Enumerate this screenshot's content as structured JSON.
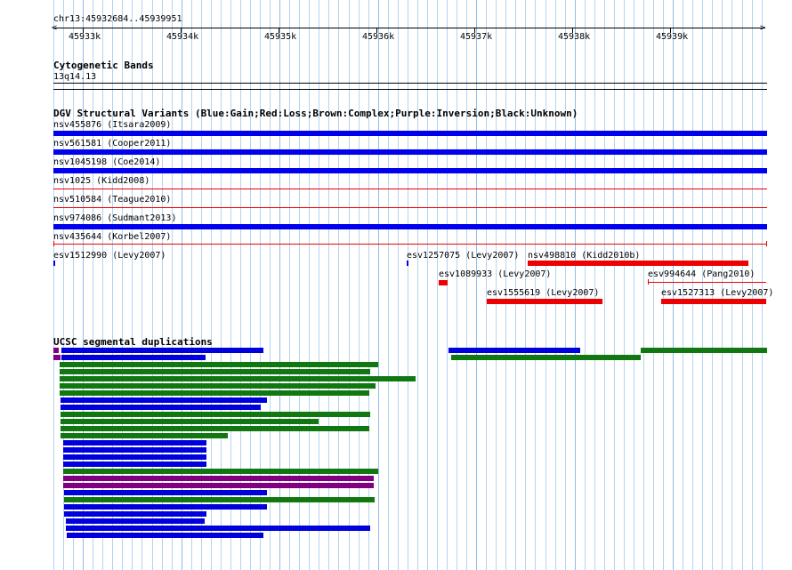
{
  "ruler": {
    "location": "chr13:45932684..45939951",
    "ticks": [
      "45933k",
      "45934k",
      "45935k",
      "45936k",
      "45937k",
      "45938k",
      "45939k"
    ]
  },
  "cytoband": {
    "title": "Cytogenetic Bands",
    "band": "13q14.13"
  },
  "dgv": {
    "title": "DGV Structural Variants (Blue:Gain;Red:Loss;Brown:Complex;Purple:Inversion;Black:Unknown)",
    "colors": {
      "gain": "#0000ee",
      "loss": "#ee0000",
      "complex": "#8b4513",
      "inversion": "#800080",
      "unknown": "#000000"
    },
    "tracks": [
      {
        "label": "nsv455876 (Itsara2009)",
        "type": "gain"
      },
      {
        "label": "nsv561581 (Cooper2011)",
        "type": "gain"
      },
      {
        "label": "nsv1045198 (Coe2014)",
        "type": "gain"
      },
      {
        "label": "nsv1025 (Kidd2008)",
        "type": "loss"
      },
      {
        "label": "nsv510584 (Teague2010)",
        "type": "loss"
      },
      {
        "label": "nsv974086 (Sudmant2013)",
        "type": "gain"
      },
      {
        "label": "nsv435644 (Korbel2007)",
        "type": "loss"
      },
      {
        "label": "esv1512990 (Levy2007)",
        "type": "gain"
      },
      {
        "label": "esv1257075 (Levy2007)",
        "type": "gain"
      },
      {
        "label": "nsv498810 (Kidd2010b)",
        "type": "loss"
      },
      {
        "label": "esv1089933 (Levy2007)",
        "type": "loss"
      },
      {
        "label": "esv994644 (Pang2010)",
        "type": "loss"
      },
      {
        "label": "esv1555619 (Levy2007)",
        "type": "loss"
      },
      {
        "label": "esv1527313 (Levy2007)",
        "type": "loss"
      }
    ]
  },
  "segdup": {
    "title": "UCSC segmental duplications",
    "colors": {
      "blue": "#0000dd",
      "green": "#117711",
      "purple": "#800080"
    }
  }
}
